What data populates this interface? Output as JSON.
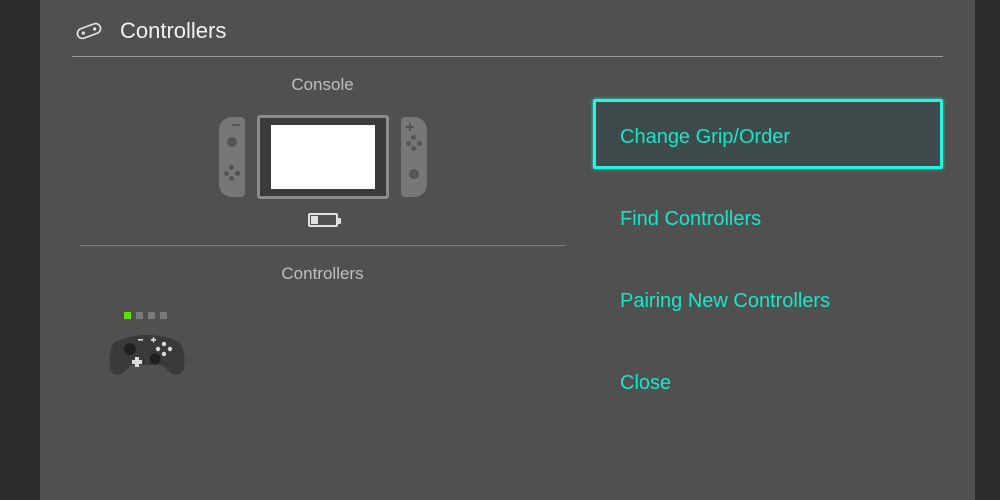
{
  "header": {
    "title": "Controllers"
  },
  "left": {
    "console_label": "Console",
    "controllers_label": "Controllers"
  },
  "menu": {
    "change_grip": "Change Grip/Order",
    "find": "Find Controllers",
    "pair": "Pairing New Controllers",
    "close": "Close"
  },
  "colors": {
    "accent": "#17e6c8",
    "player_on": "#63de00"
  }
}
